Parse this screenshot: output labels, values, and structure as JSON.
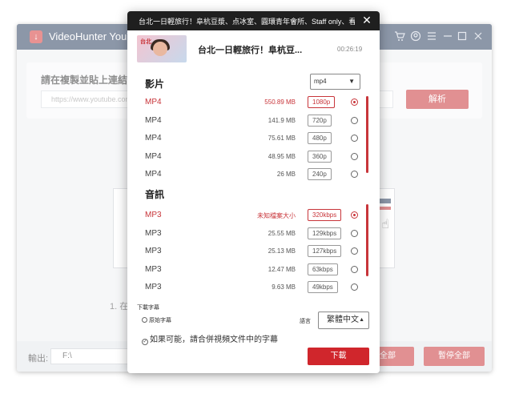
{
  "app": {
    "title": "VideoHunter YouTube",
    "paste_label": "請在複製並貼上連結",
    "url_placeholder": "https://www.youtube.com",
    "analyze_label": "解析",
    "step_text": "1. 在",
    "output_label": "輸出:",
    "output_path": "F:\\",
    "download_all_label": "全部",
    "pause_all_label": "暫停全部",
    "logo_glyph": "↓"
  },
  "dialog": {
    "header_title": "台北一日輕旅行！阜杭豆漿、点冰室、圓環青年會所、Staff only、看板...",
    "video_title": "台北一日輕旅行！阜杭豆...",
    "duration": "00:26:19",
    "thumb_tag": "台北",
    "video_section": "影片",
    "format_value": "mp4",
    "video_rows": [
      {
        "format": "MP4",
        "size": "550.89 MB",
        "quality": "1080p",
        "selected": true
      },
      {
        "format": "MP4",
        "size": "141.9 MB",
        "quality": "720p",
        "selected": false
      },
      {
        "format": "MP4",
        "size": "75.61 MB",
        "quality": "480p",
        "selected": false
      },
      {
        "format": "MP4",
        "size": "48.95 MB",
        "quality": "360p",
        "selected": false
      },
      {
        "format": "MP4",
        "size": "26 MB",
        "quality": "240p",
        "selected": false
      }
    ],
    "audio_section": "音訊",
    "audio_rows": [
      {
        "format": "MP3",
        "size": "未知檔案大小",
        "quality": "320kbps",
        "selected": true
      },
      {
        "format": "MP3",
        "size": "25.55 MB",
        "quality": "129kbps",
        "selected": false
      },
      {
        "format": "MP3",
        "size": "25.13 MB",
        "quality": "127kbps",
        "selected": false
      },
      {
        "format": "MP3",
        "size": "12.47 MB",
        "quality": "63kbps",
        "selected": false
      },
      {
        "format": "MP3",
        "size": "9.63 MB",
        "quality": "49kbps",
        "selected": false
      }
    ],
    "subs_title": "下載字幕",
    "orig_subs_label": "原始字幕",
    "lang_label": "語言",
    "lang_value": "繁體中文",
    "merge_subs_label": "如果可能，請合併視頻文件中的字幕",
    "download_label": "下載",
    "accent_color": "#c8353a"
  }
}
